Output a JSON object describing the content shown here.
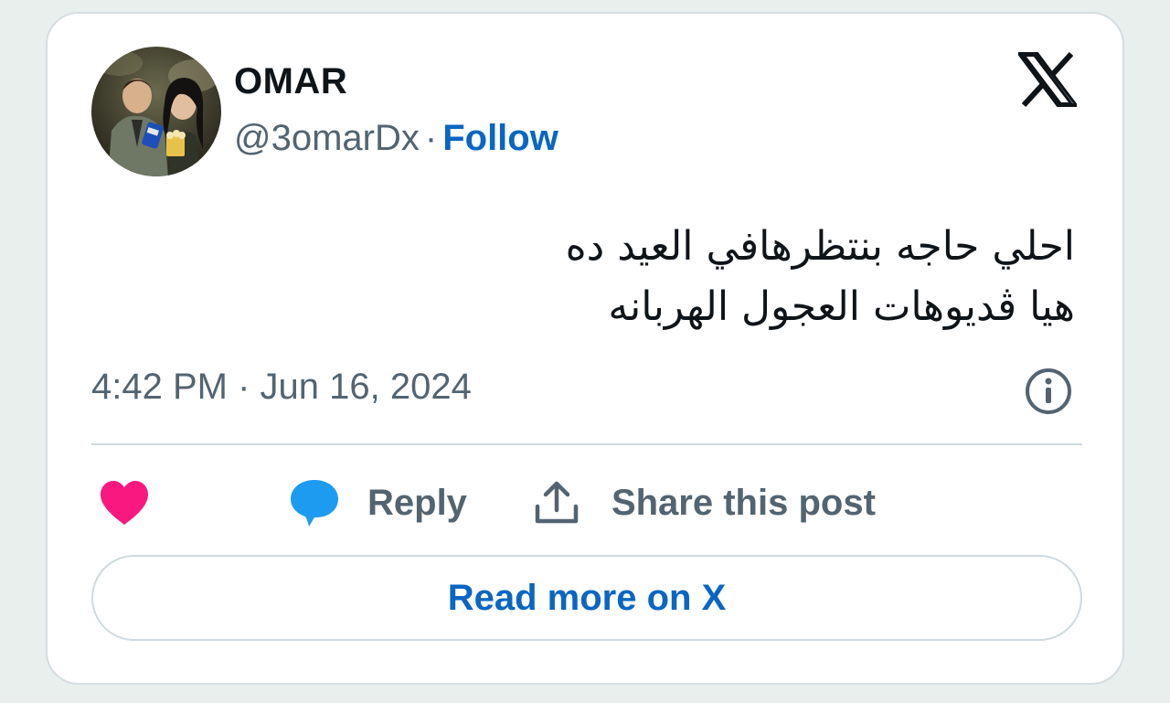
{
  "author": {
    "display_name": "OMAR",
    "handle": "@3omarDx",
    "separator": "·",
    "follow_label": "Follow",
    "avatar": "profile-photo"
  },
  "brand": {
    "logo": "x-logo-icon"
  },
  "post": {
    "lines": [
      "احلي حاجه بنتظرهافي  العيد ده",
      "هيا ڤديوهات العجول الهربانه"
    ],
    "timestamp": "4:42 PM · Jun 16, 2024"
  },
  "actions": {
    "like_icon": "heart-icon",
    "reply_icon": "speech-bubble-icon",
    "reply_label": "Reply",
    "share_icon": "share-upload-icon",
    "share_label": "Share this post",
    "info_icon": "info-icon"
  },
  "footer": {
    "read_more_label": "Read more on X"
  },
  "colors": {
    "background": "#e9efed",
    "card": "#ffffff",
    "text_primary": "#0f1419",
    "text_secondary": "#536471",
    "link": "#0a66c2",
    "heart": "#f91880",
    "reply_bubble": "#1d9bf0",
    "border": "#cfd9de"
  }
}
